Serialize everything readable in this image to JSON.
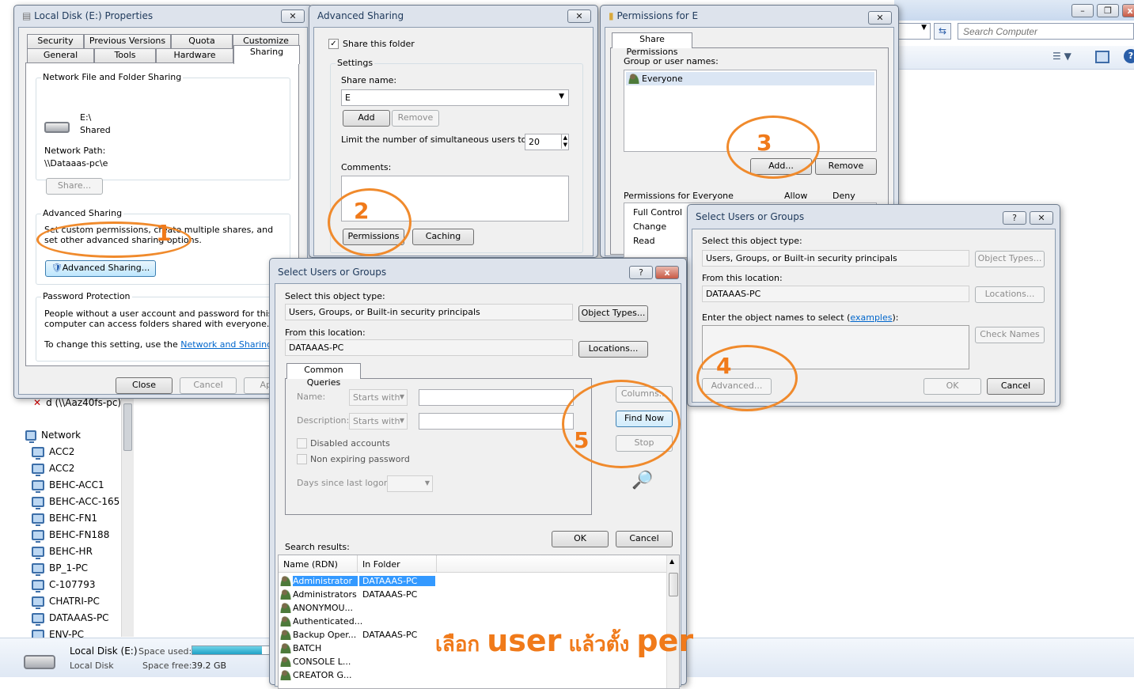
{
  "explorer": {
    "search_placeholder": "Search Computer",
    "nav_items": [
      {
        "label": "d (\\\\Aaz40fs-pc)"
      },
      {
        "label": "Network"
      },
      {
        "label": "ACC2"
      },
      {
        "label": "ACC2"
      },
      {
        "label": "BEHC-ACC1"
      },
      {
        "label": "BEHC-ACC-165"
      },
      {
        "label": "BEHC-FN1"
      },
      {
        "label": "BEHC-FN188"
      },
      {
        "label": "BEHC-HR"
      },
      {
        "label": "BP_1-PC"
      },
      {
        "label": "C-107793"
      },
      {
        "label": "CHATRI-PC"
      },
      {
        "label": "DATAAAS-PC"
      },
      {
        "label": "ENV-PC"
      }
    ],
    "status": {
      "drive_name": "Local Disk (E:)",
      "drive_type": "Local Disk",
      "space_used_label": "Space used:",
      "space_free_label": "Space free:",
      "space_free_value": "39.2 GB",
      "used_fraction": 0.9
    }
  },
  "properties": {
    "title": "Local Disk (E:) Properties",
    "tabs_row1": [
      "Security",
      "Previous Versions",
      "Quota",
      "Customize"
    ],
    "tabs_row2": [
      "General",
      "Tools",
      "Hardware",
      "Sharing"
    ],
    "nffs_label": "Network File and Folder Sharing",
    "drive_label": "E:\\",
    "drive_state": "Shared",
    "network_path_label": "Network Path:",
    "network_path": "\\\\Dataaas-pc\\e",
    "share_button": "Share...",
    "adv_label": "Advanced Sharing",
    "adv_desc": "Set custom permissions, create multiple shares, and set other advanced sharing options.",
    "adv_button": "Advanced Sharing...",
    "pp_label": "Password Protection",
    "pp_desc": "People without a user account and password for this computer can access folders shared with everyone.",
    "pp_change": "To change this setting, use the ",
    "pp_link": "Network and Sharing Center",
    "close": "Close",
    "cancel": "Cancel",
    "apply": "Apply"
  },
  "advanced_sharing": {
    "title": "Advanced Sharing",
    "share_folder": "Share this folder",
    "settings": "Settings",
    "share_name_label": "Share name:",
    "share_name": "E",
    "add": "Add",
    "remove": "Remove",
    "limit_label": "Limit the number of simultaneous users to:",
    "limit_value": "20",
    "comments_label": "Comments:",
    "permissions": "Permissions",
    "caching": "Caching"
  },
  "permissions": {
    "title": "Permissions for E",
    "tab": "Share Permissions",
    "group_label": "Group or user names:",
    "group": "Everyone",
    "add": "Add...",
    "remove": "Remove",
    "perm_for": "Permissions for Everyone",
    "allow": "Allow",
    "deny": "Deny",
    "perms": [
      "Full Control",
      "Change",
      "Read"
    ]
  },
  "select_small": {
    "title": "Select Users or Groups",
    "obj_type_label": "Select this object type:",
    "obj_type": "Users, Groups, or Built-in security principals",
    "obj_types_btn": "Object Types...",
    "from_label": "From this location:",
    "location": "DATAAAS-PC",
    "locations_btn": "Locations...",
    "enter_label": "Enter the object names to select (",
    "examples": "examples",
    "enter_end": "):",
    "check_names": "Check Names",
    "advanced": "Advanced...",
    "ok": "OK",
    "cancel": "Cancel"
  },
  "select_adv": {
    "title": "Select Users or Groups",
    "obj_type_label": "Select this object type:",
    "obj_type": "Users, Groups, or Built-in security principals",
    "obj_types_btn": "Object Types...",
    "from_label": "From this location:",
    "location": "DATAAAS-PC",
    "locations_btn": "Locations...",
    "tab": "Common Queries",
    "name_label": "Name:",
    "desc_label": "Description:",
    "starts_with": "Starts with",
    "disabled": "Disabled accounts",
    "non_expiring": "Non expiring password",
    "days_label": "Days since last logon:",
    "columns": "Columns...",
    "find_now": "Find Now",
    "stop": "Stop",
    "ok": "OK",
    "cancel": "Cancel",
    "results_label": "Search results:",
    "col_name": "Name (RDN)",
    "col_folder": "In Folder",
    "results": [
      {
        "name": "Administrator",
        "folder": "DATAAAS-PC"
      },
      {
        "name": "Administrators",
        "folder": "DATAAAS-PC"
      },
      {
        "name": "ANONYMOU...",
        "folder": ""
      },
      {
        "name": "Authenticated...",
        "folder": ""
      },
      {
        "name": "Backup Oper...",
        "folder": "DATAAAS-PC"
      },
      {
        "name": "BATCH",
        "folder": ""
      },
      {
        "name": "CONSOLE L...",
        "folder": ""
      },
      {
        "name": "CREATOR G...",
        "folder": ""
      }
    ]
  },
  "annotations": {
    "n1": "1",
    "n2": "2",
    "n3": "3",
    "n4": "4",
    "n5": "5",
    "caption_a": "เลือก ",
    "caption_b": "user",
    "caption_c": " แล้วตั้ง ",
    "caption_d": "per",
    "color": "#f07a1a"
  }
}
